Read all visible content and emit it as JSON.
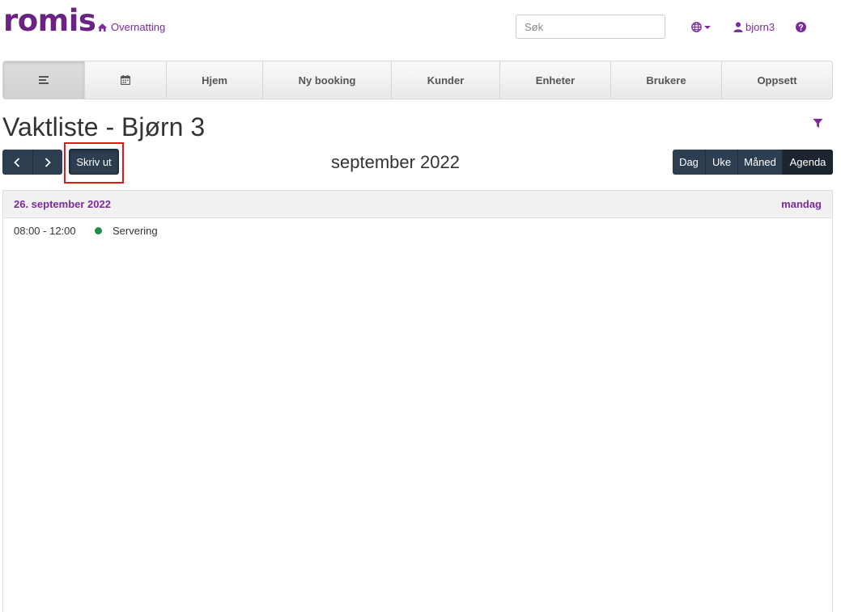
{
  "brand": {
    "logo": "romis",
    "link": "Overnatting",
    "logo_color": "#6b2383"
  },
  "header": {
    "search_placeholder": "Søk",
    "user": "bjorn3"
  },
  "nav": {
    "items": [
      "",
      "",
      "Hjem",
      "Ny booking",
      "Kunder",
      "Enheter",
      "Brukere",
      "Oppsett"
    ]
  },
  "page": {
    "title": "Vaktliste - Bjørn 3"
  },
  "toolbar": {
    "print": "Skriv ut",
    "month": "september 2022",
    "views": [
      "Dag",
      "Uke",
      "Måned",
      "Agenda"
    ],
    "active_view": "Agenda"
  },
  "agenda": {
    "day": {
      "date": "26. september 2022",
      "weekday": "mandag"
    },
    "events": [
      {
        "time": "08:00 - 12:00",
        "title": "Servering",
        "color": "#1b8f48"
      }
    ]
  },
  "colors": {
    "accent": "#7b2a9c",
    "dark_button": "#2c3e50"
  }
}
